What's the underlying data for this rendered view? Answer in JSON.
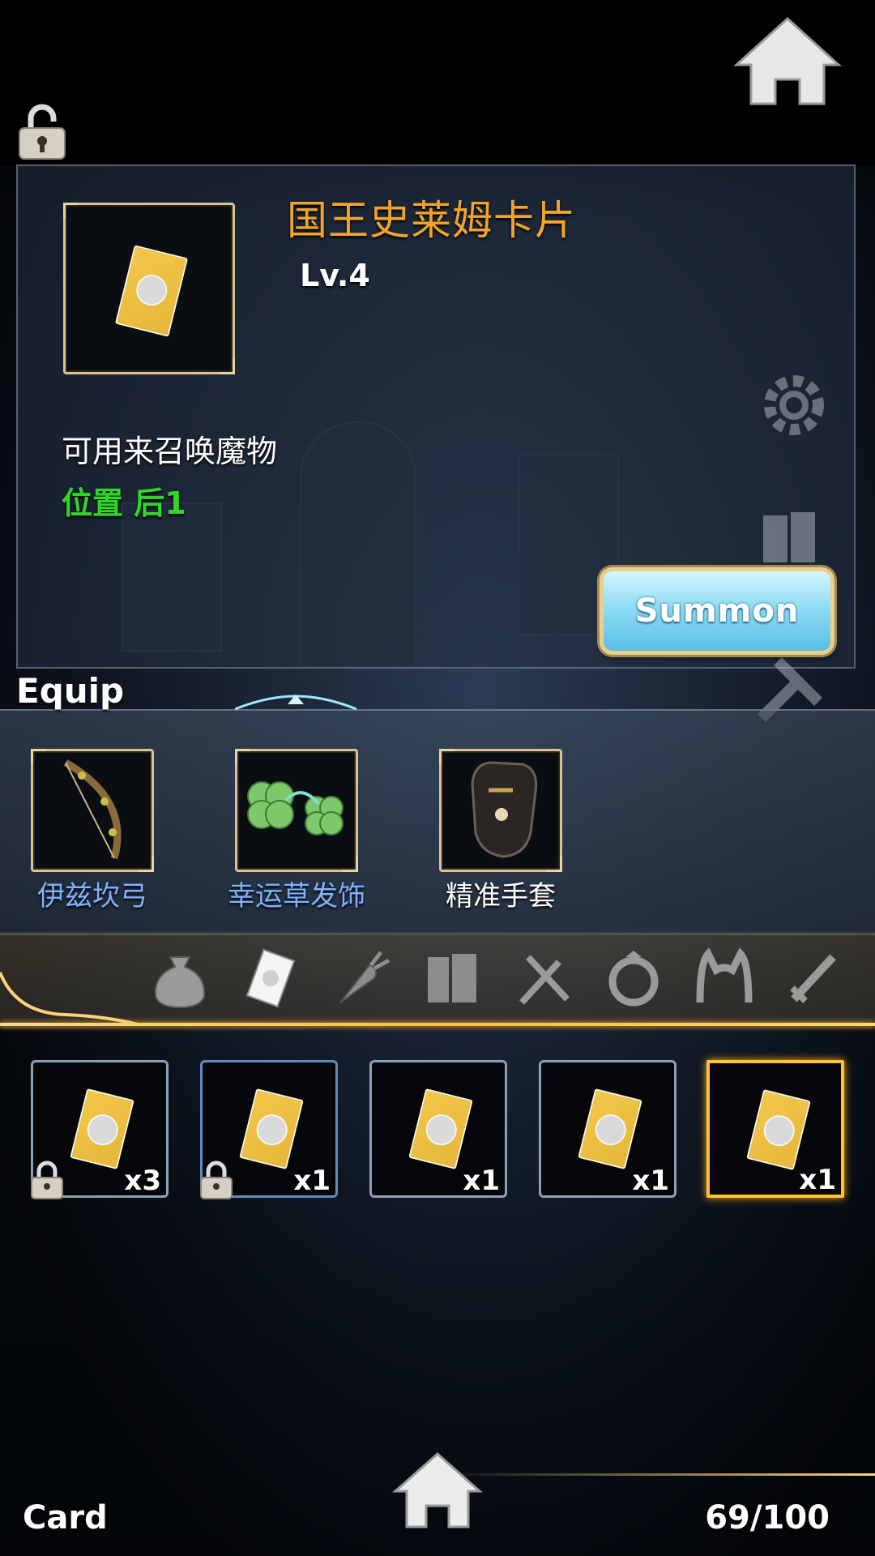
{
  "item": {
    "title": "国王史莱姆卡片",
    "level": "Lv.4",
    "description": "可用来召唤魔物",
    "position": "位置 后1",
    "action_label": "Summon"
  },
  "equip": {
    "label": "Equip",
    "items": [
      {
        "name": "伊兹坎弓",
        "icon": "bow-icon",
        "color": "#7fb2ff"
      },
      {
        "name": "幸运草发饰",
        "icon": "clover-icon",
        "color": "#7fb2ff"
      },
      {
        "name": "精准手套",
        "icon": "glove-icon",
        "color": "#ffffff"
      }
    ]
  },
  "tabs": [
    {
      "icon": "bag-icon",
      "active": false
    },
    {
      "icon": "card-icon",
      "active": true
    },
    {
      "icon": "carrot-icon",
      "active": false
    },
    {
      "icon": "book-icon",
      "active": false
    },
    {
      "icon": "fork-spoon-icon",
      "active": false
    },
    {
      "icon": "ring-icon",
      "active": false
    },
    {
      "icon": "cat-ears-icon",
      "active": false
    },
    {
      "icon": "sword-icon",
      "active": false
    }
  ],
  "inventory": [
    {
      "qty": "x3",
      "locked": true,
      "selected": false
    },
    {
      "qty": "x1",
      "locked": true,
      "selected": false
    },
    {
      "qty": "x1",
      "locked": false,
      "selected": false
    },
    {
      "qty": "x1",
      "locked": false,
      "selected": false
    },
    {
      "qty": "x1",
      "locked": false,
      "selected": true
    }
  ],
  "footer": {
    "category": "Card",
    "capacity": "69/100"
  },
  "colors": {
    "title": "#f2a42c",
    "position": "#30d62a",
    "accent_gold": "#ffc23a",
    "equip_blue_name": "#7fb2ff"
  }
}
